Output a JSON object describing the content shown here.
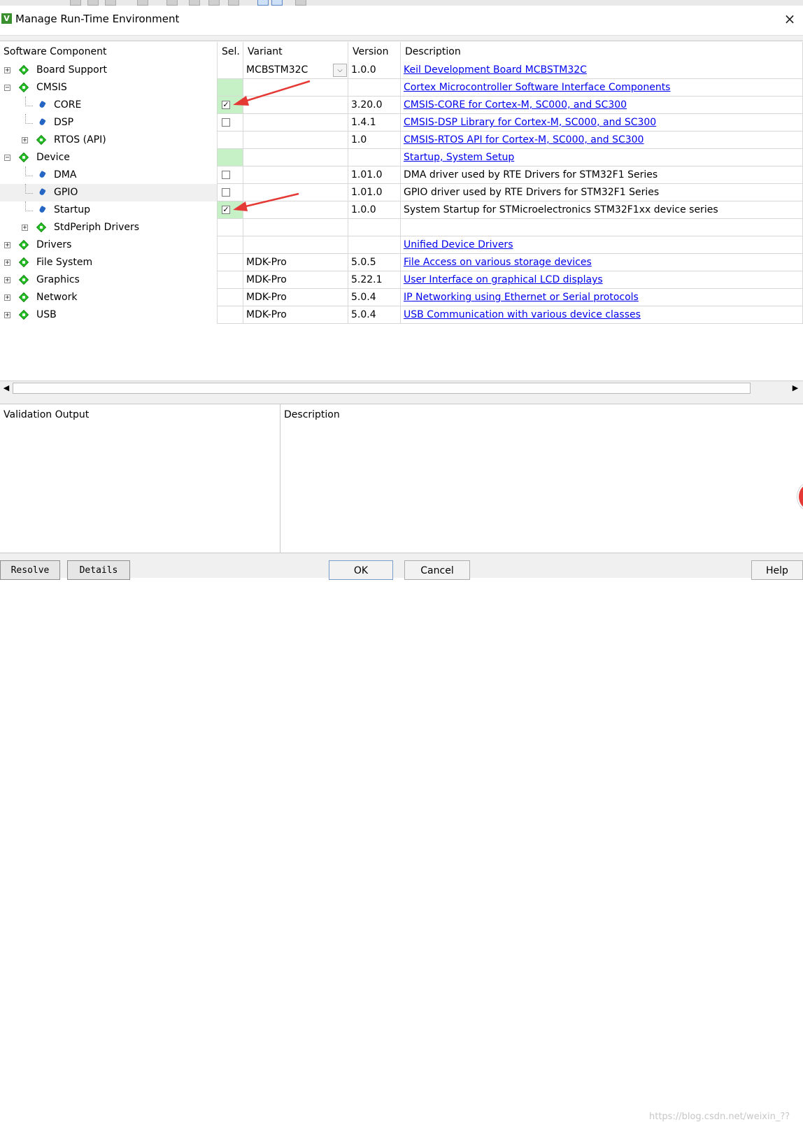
{
  "window": {
    "title": "Manage Run-Time Environment",
    "icon_letter": "V",
    "close_label": "×"
  },
  "columns": {
    "component": "Software Component",
    "sel": "Sel.",
    "variant": "Variant",
    "version": "Version",
    "description": "Description"
  },
  "rows": [
    {
      "name": "Board Support",
      "level": 0,
      "expander": "+",
      "icon": "diamond-icon",
      "sel": "",
      "sel_bg": "",
      "variant": "MCBSTM32C",
      "has_combo": true,
      "version": "1.0.0",
      "description": "Keil Development Board MCBSTM32C",
      "desc_link": true
    },
    {
      "name": "CMSIS",
      "level": 0,
      "expander": "-",
      "icon": "diamond-icon",
      "sel": "",
      "sel_bg": "green",
      "variant": "",
      "version": "",
      "description": "Cortex Microcontroller Software Interface Components",
      "desc_link": true
    },
    {
      "name": "CORE",
      "level": 1,
      "expander": "",
      "icon": "gem-icon",
      "sel": "checked",
      "sel_bg": "green",
      "variant": "",
      "version": "3.20.0",
      "description": "CMSIS-CORE for Cortex-M, SC000, and SC300",
      "desc_link": true
    },
    {
      "name": "DSP",
      "level": 1,
      "expander": "",
      "icon": "gem-icon",
      "sel": "unchecked",
      "sel_bg": "",
      "variant": "",
      "version": "1.4.1",
      "description": "CMSIS-DSP Library for Cortex-M, SC000, and SC300",
      "desc_link": true
    },
    {
      "name": "RTOS (API)",
      "level": 1,
      "expander": "+",
      "icon": "diamond-icon",
      "sel": "",
      "sel_bg": "",
      "variant": "",
      "version": "1.0",
      "description": "CMSIS-RTOS API for Cortex-M, SC000, and SC300",
      "desc_link": true
    },
    {
      "name": "Device",
      "level": 0,
      "expander": "-",
      "icon": "diamond-icon",
      "sel": "",
      "sel_bg": "green",
      "variant": "",
      "version": "",
      "description": "Startup, System Setup",
      "desc_link": true
    },
    {
      "name": "DMA",
      "level": 1,
      "expander": "",
      "icon": "gem-icon",
      "sel": "unchecked",
      "sel_bg": "",
      "variant": "",
      "version": "1.01.0",
      "description": "DMA driver used by RTE Drivers for STM32F1 Series",
      "desc_link": false
    },
    {
      "name": "GPIO",
      "level": 1,
      "expander": "",
      "icon": "gem-icon",
      "sel": "unchecked",
      "sel_bg": "",
      "variant": "",
      "version": "1.01.0",
      "description": "GPIO driver used by RTE Drivers for STM32F1 Series",
      "desc_link": false,
      "highlight": true
    },
    {
      "name": "Startup",
      "level": 1,
      "expander": "",
      "icon": "gem-icon",
      "sel": "checked",
      "sel_bg": "green",
      "variant": "",
      "version": "1.0.0",
      "description": "System Startup for STMicroelectronics STM32F1xx device series",
      "desc_link": false
    },
    {
      "name": "StdPeriph Drivers",
      "level": 1,
      "expander": "+",
      "icon": "diamond-icon",
      "sel": "",
      "sel_bg": "",
      "variant": "",
      "version": "",
      "description": "",
      "desc_link": false
    },
    {
      "name": "Drivers",
      "level": 0,
      "expander": "+",
      "icon": "diamond-icon",
      "sel": "",
      "sel_bg": "",
      "variant": "",
      "version": "",
      "description": "Unified Device Drivers",
      "desc_link": true
    },
    {
      "name": "File System",
      "level": 0,
      "expander": "+",
      "icon": "diamond-icon",
      "sel": "",
      "sel_bg": "",
      "variant": "MDK-Pro",
      "version": "5.0.5",
      "description": "File Access on various storage devices",
      "desc_link": true
    },
    {
      "name": "Graphics",
      "level": 0,
      "expander": "+",
      "icon": "diamond-icon",
      "sel": "",
      "sel_bg": "",
      "variant": "MDK-Pro",
      "version": "5.22.1",
      "description": "User Interface on graphical LCD displays",
      "desc_link": true
    },
    {
      "name": "Network",
      "level": 0,
      "expander": "+",
      "icon": "diamond-icon",
      "sel": "",
      "sel_bg": "",
      "variant": "MDK-Pro",
      "version": "5.0.4",
      "description": "IP Networking using Ethernet or Serial protocols",
      "desc_link": true
    },
    {
      "name": "USB",
      "level": 0,
      "expander": "+",
      "icon": "diamond-icon",
      "sel": "",
      "sel_bg": "",
      "variant": "MDK-Pro",
      "version": "5.0.4",
      "description": "USB Communication with various device classes",
      "desc_link": true
    }
  ],
  "scroll": {
    "left": "◀",
    "right": "▶"
  },
  "lower": {
    "validation_header": "Validation Output",
    "description_header": "Description"
  },
  "buttons": {
    "resolve": "Resolve",
    "details": "Details",
    "ok": "OK",
    "cancel": "Cancel",
    "help": "Help"
  },
  "watermark": "https://blog.csdn.net/weixin_??",
  "colors": {
    "selected_cell": "#c6f0c6",
    "link": "#0000ee",
    "annotation_arrow": "#e53935"
  }
}
